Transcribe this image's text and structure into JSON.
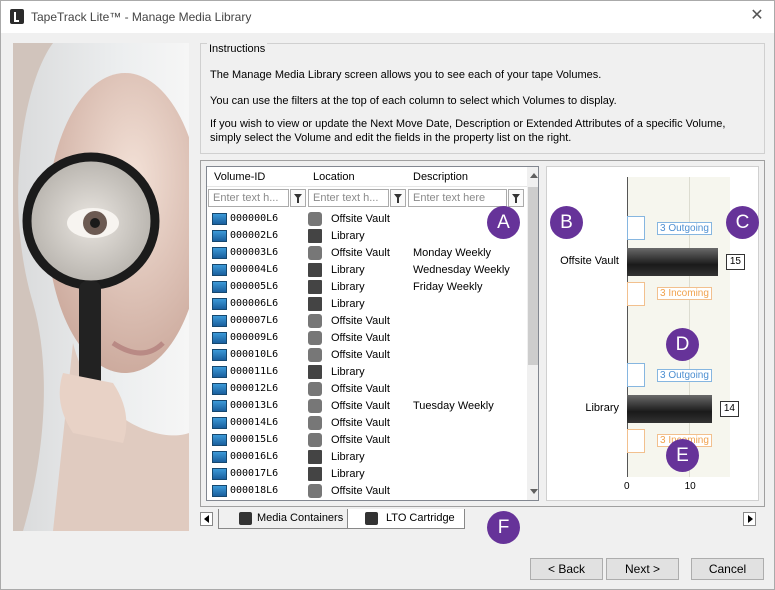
{
  "window": {
    "title": "TapeTrack Lite™ - Manage Media Library",
    "close_glyph": "✕"
  },
  "instructions": {
    "title": "Instructions",
    "p1": "The Manage Media Library screen allows you to see each of your tape Volumes.",
    "p2": "You can use the filters at the top of each column to select which Volumes to display.",
    "p3": "If you wish to view or update the Next Move Date, Description or Extended Attributes of a specific Volume, simply select the Volume and edit the fields in the property list on the right."
  },
  "grid": {
    "headers": {
      "volume": "Volume-ID",
      "location": "Location",
      "description": "Description"
    },
    "filters": {
      "volume": "Enter text h...",
      "location": "Enter text h...",
      "description": "Enter text here"
    },
    "rows": [
      {
        "id": "000000L6",
        "location": "Offsite Vault",
        "description": ""
      },
      {
        "id": "000002L6",
        "location": "Library",
        "description": ""
      },
      {
        "id": "000003L6",
        "location": "Offsite Vault",
        "description": "Monday Weekly"
      },
      {
        "id": "000004L6",
        "location": "Library",
        "description": "Wednesday Weekly"
      },
      {
        "id": "000005L6",
        "location": "Library",
        "description": "Friday Weekly"
      },
      {
        "id": "000006L6",
        "location": "Library",
        "description": ""
      },
      {
        "id": "000007L6",
        "location": "Offsite Vault",
        "description": ""
      },
      {
        "id": "000009L6",
        "location": "Offsite Vault",
        "description": ""
      },
      {
        "id": "000010L6",
        "location": "Offsite Vault",
        "description": ""
      },
      {
        "id": "000011L6",
        "location": "Library",
        "description": ""
      },
      {
        "id": "000012L6",
        "location": "Offsite Vault",
        "description": ""
      },
      {
        "id": "000013L6",
        "location": "Offsite Vault",
        "description": "Tuesday Weekly"
      },
      {
        "id": "000014L6",
        "location": "Offsite Vault",
        "description": ""
      },
      {
        "id": "000015L6",
        "location": "Offsite Vault",
        "description": ""
      },
      {
        "id": "000016L6",
        "location": "Library",
        "description": ""
      },
      {
        "id": "000017L6",
        "location": "Library",
        "description": ""
      },
      {
        "id": "000018L6",
        "location": "Offsite Vault",
        "description": ""
      }
    ]
  },
  "chart_data": {
    "type": "bar",
    "categories": [
      "Offsite Vault",
      "Library"
    ],
    "values": [
      15,
      14
    ],
    "outgoing_labels": [
      "3 Outgoing",
      "3 Outgoing"
    ],
    "incoming_labels": [
      "3 Incoming",
      "3 Incoming"
    ],
    "xlim": [
      0,
      17
    ],
    "xticks": [
      "0",
      "10"
    ],
    "value_labels": [
      "15",
      "14"
    ],
    "colors": {
      "bar": "#222222",
      "outgoing": "#4d8fd1",
      "incoming": "#f0a24e"
    }
  },
  "markers": {
    "a": "A",
    "b": "B",
    "c": "C",
    "d": "D",
    "e": "E",
    "f": "F"
  },
  "tabs": {
    "media_containers": "Media Containers",
    "lto_cartridge": "LTO Cartridge"
  },
  "buttons": {
    "back": "< Back",
    "next": "Next >",
    "cancel": "Cancel"
  },
  "colors": {
    "marker": "#663399",
    "accent": "#1e78c8"
  }
}
